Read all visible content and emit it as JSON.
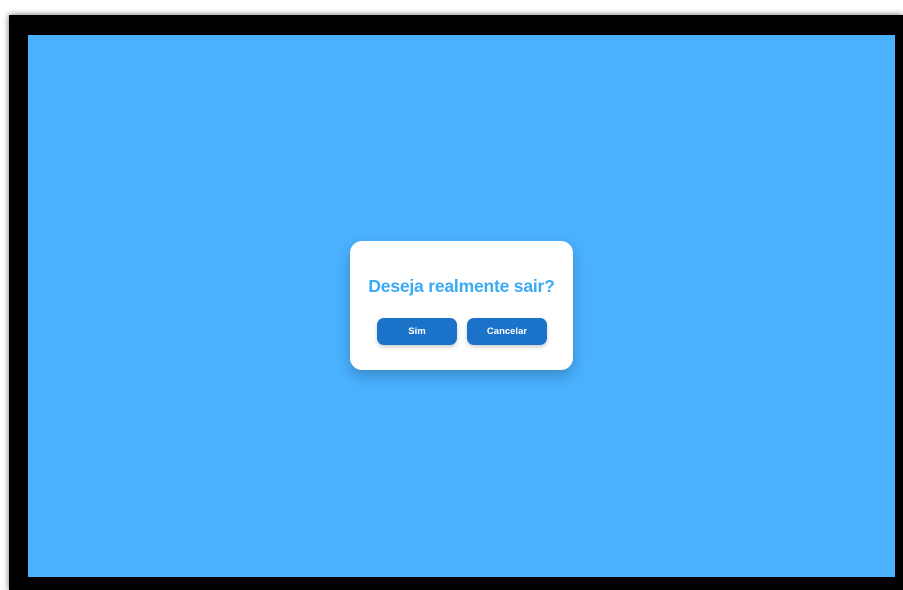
{
  "dialog": {
    "title": "Deseja realmente sair?",
    "confirm_label": "Sim",
    "cancel_label": "Cancelar"
  },
  "colors": {
    "background": "#4ab1ff",
    "title": "#3aaaf5",
    "button": "#1a72c9",
    "frame": "#000000"
  }
}
